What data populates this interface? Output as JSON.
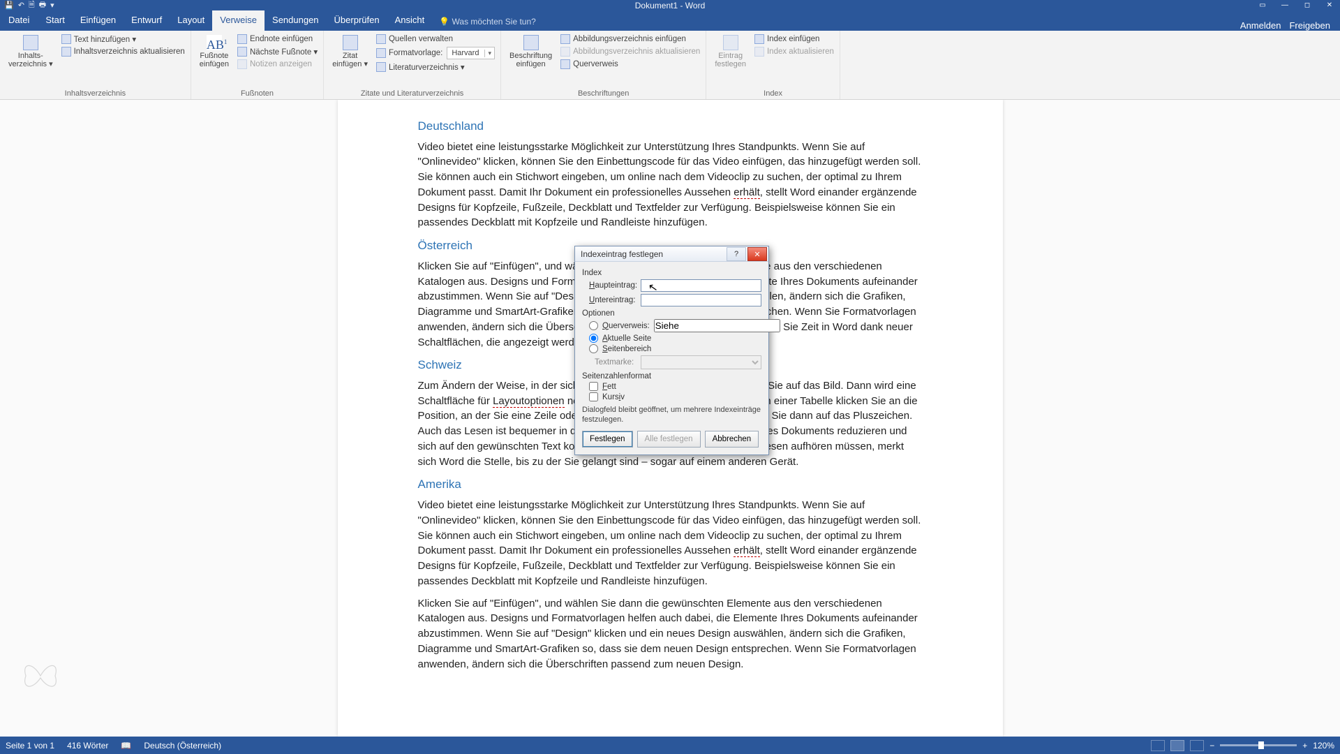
{
  "app": {
    "title": "Dokument1 - Word"
  },
  "qa_tips": [
    "💾",
    "↶",
    "🗎",
    "🖶",
    "▾"
  ],
  "winctrl": [
    "▭",
    "—",
    "◻",
    "✕"
  ],
  "tabs": {
    "file": "Datei",
    "items": [
      "Start",
      "Einfügen",
      "Entwurf",
      "Layout",
      "Verweise",
      "Sendungen",
      "Überprüfen",
      "Ansicht"
    ],
    "active": "Verweise",
    "tellme_icon": "💡",
    "tellme": "Was möchten Sie tun?",
    "sign_in": "Anmelden",
    "share": "Freigeben"
  },
  "ribbon": {
    "g1": {
      "name": "Inhaltsverzeichnis",
      "big": "Inhalts-\nverzeichnis ▾",
      "r1": "Text hinzufügen ▾",
      "r2": "Inhaltsverzeichnis aktualisieren"
    },
    "g2": {
      "name": "Fußnoten",
      "big_icon": "AB",
      "big": "Fußnote\neinfügen",
      "r1": "Endnote einfügen",
      "r2": "Nächste Fußnote ▾",
      "r3": "Notizen anzeigen"
    },
    "g3": {
      "name": "Zitate und Literaturverzeichnis",
      "big": "Zitat\neinfügen ▾",
      "r1": "Quellen verwalten",
      "r2_lbl": "Formatvorlage:",
      "r2_val": "Harvard",
      "r3": "Literaturverzeichnis ▾"
    },
    "g4": {
      "name": "Beschriftungen",
      "big": "Beschriftung\neinfügen",
      "r1": "Abbildungsverzeichnis einfügen",
      "r2": "Abbildungsverzeichnis aktualisieren",
      "r3": "Querverweis"
    },
    "g5": {
      "name": "Index",
      "big": "Eintrag\nfestlegen",
      "r1": "Index einfügen",
      "r2": "Index aktualisieren"
    }
  },
  "doc": {
    "h1": "Deutschland",
    "p1a": "Video bietet eine leistungsstarke Möglichkeit zur Unterstützung Ihres Standpunkts. Wenn Sie auf \"Onlinevideo\" klicken, können Sie den Einbettungscode für das Video einfügen, das hinzugefügt werden soll. Sie können auch ein Stichwort eingeben, um online nach dem Videoclip zu suchen, der optimal zu Ihrem Dokument passt. Damit Ihr Dokument ein professionelles Aussehen ",
    "p1b": "erhält",
    "p1c": ", stellt Word einander ergänzende Designs für Kopfzeile, Fußzeile, Deckblatt und Textfelder zur Verfügung. Beispielsweise können Sie ein passendes Deckblatt mit Kopfzeile und Randleiste hinzufügen.",
    "h2": "Österreich",
    "p2": "Klicken Sie auf \"Einfügen\", und wählen Sie dann die gewünschten Elemente aus den verschiedenen Katalogen aus. Designs und Formatvorlagen helfen auch dabei, die Elemente Ihres Dokuments aufeinander abzustimmen. Wenn Sie auf \"Design\" klicken und ein neues Design auswählen, ändern sich die Grafiken, Diagramme und SmartArt-Grafiken so, dass sie dem neuen Design entsprechen. Wenn Sie Formatvorlagen anwenden, ändern sich die Überschriften passend zum neuen Design. Sparen Sie Zeit in Word dank neuer Schaltflächen, die angezeigt werden, wo Sie sie benötigen.",
    "h3": "Schweiz",
    "p3a": "Zum Ändern der Weise, in der sich ein Bild in Ihr Dokument einfügt, klicken Sie auf das Bild. Dann wird eine Schaltfläche für ",
    "p3b": "Layoutoptionen",
    "p3c": " neben dem Bild angezeigt Beim Arbeiten an einer Tabelle klicken Sie an die Position, an der Sie eine Zeile oder Spalte hinzufügen möchten, und klicken Sie dann auf das Pluszeichen. Auch das Lesen ist bequemer in der neuen Leseansicht. Sie können Teile des Dokuments reduzieren und sich auf den gewünschten Text konzentrieren. Wenn Sie vor dem Ende zu lesen aufhören müssen, merkt sich Word die Stelle, bis zu der Sie gelangt sind – sogar auf einem anderen Gerät.",
    "h4": "Amerika",
    "p4a": "Video bietet eine leistungsstarke Möglichkeit zur Unterstützung Ihres Standpunkts. Wenn Sie auf \"Onlinevideo\" klicken, können Sie den Einbettungscode für das Video einfügen, das hinzugefügt werden soll. Sie können auch ein Stichwort eingeben, um online nach dem Videoclip zu suchen, der optimal zu Ihrem Dokument passt. Damit Ihr Dokument ein professionelles Aussehen ",
    "p4b": "erhält",
    "p4c": ", stellt Word einander ergänzende Designs für Kopfzeile, Fußzeile, Deckblatt und Textfelder zur Verfügung. Beispielsweise können Sie ein passendes Deckblatt mit Kopfzeile und Randleiste hinzufügen.",
    "p5": "Klicken Sie auf \"Einfügen\", und wählen Sie dann die gewünschten Elemente aus den verschiedenen Katalogen aus. Designs und Formatvorlagen helfen auch dabei, die Elemente Ihres Dokuments aufeinander abzustimmen. Wenn Sie auf \"Design\" klicken und ein neues Design auswählen, ändern sich die Grafiken, Diagramme und SmartArt-Grafiken so, dass sie dem neuen Design entsprechen. Wenn Sie Formatvorlagen anwenden, ändern sich die Überschriften passend zum neuen Design."
  },
  "dialog": {
    "title": "Indexeintrag festlegen",
    "s_index": "Index",
    "main_lbl": "Haupteintrag:",
    "sub_lbl": "Untereintrag:",
    "s_opts": "Optionen",
    "opt_xref": "Querverweis:",
    "xref_val": "Siehe",
    "opt_page": "Aktuelle Seite",
    "opt_range": "Seitenbereich",
    "bm_lbl": "Textmarke:",
    "s_fmt": "Seitenzahlenformat",
    "fmt_bold": "Fett",
    "fmt_italic": "Kursiv",
    "note": "Dialogfeld bleibt geöffnet, um mehrere Indexeinträge festzulegen.",
    "btn_mark": "Festlegen",
    "btn_markall": "Alle festlegen",
    "btn_cancel": "Abbrechen"
  },
  "status": {
    "page": "Seite 1 von 1",
    "words": "416 Wörter",
    "proof_icon": "📖",
    "lang": "Deutsch (Österreich)",
    "zoom_minus": "−",
    "zoom_plus": "+",
    "zoom": "120%"
  }
}
